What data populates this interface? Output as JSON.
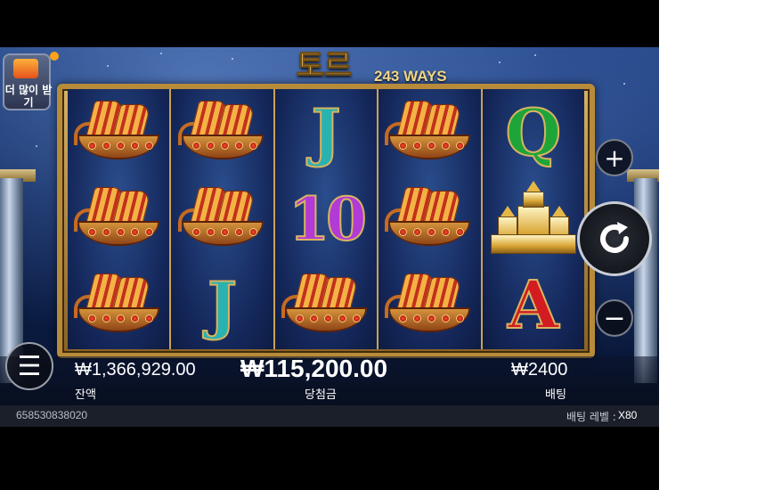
{
  "game": {
    "logo": "토르",
    "ways": "243 WAYS"
  },
  "promo": {
    "label": "더 많이 받기",
    "icon": "gift-icon"
  },
  "reels": [
    [
      "ship",
      "ship",
      "ship"
    ],
    [
      "ship",
      "ship",
      "J"
    ],
    [
      "J",
      "10",
      "ship"
    ],
    [
      "ship",
      "ship",
      "ship"
    ],
    [
      "Q",
      "castle",
      "A"
    ]
  ],
  "symbols": {
    "J": "J",
    "10": "10",
    "Q": "Q",
    "A": "A"
  },
  "controls": {
    "plus_icon": "+",
    "minus_icon": "−",
    "spin_icon": "↻",
    "menu_icon": "☰"
  },
  "balance": {
    "value": "₩1,366,929.00",
    "label": "잔액"
  },
  "win": {
    "value": "₩115,200.00",
    "label": "당첨금"
  },
  "bet": {
    "value": "₩2400",
    "label": "배팅"
  },
  "info": {
    "session_id": "658530838020",
    "bet_level_label": "배팅 레벨 :",
    "bet_level_value": "X80"
  },
  "colors": {
    "gold": "#d8b460",
    "sky": "#0c2254"
  }
}
